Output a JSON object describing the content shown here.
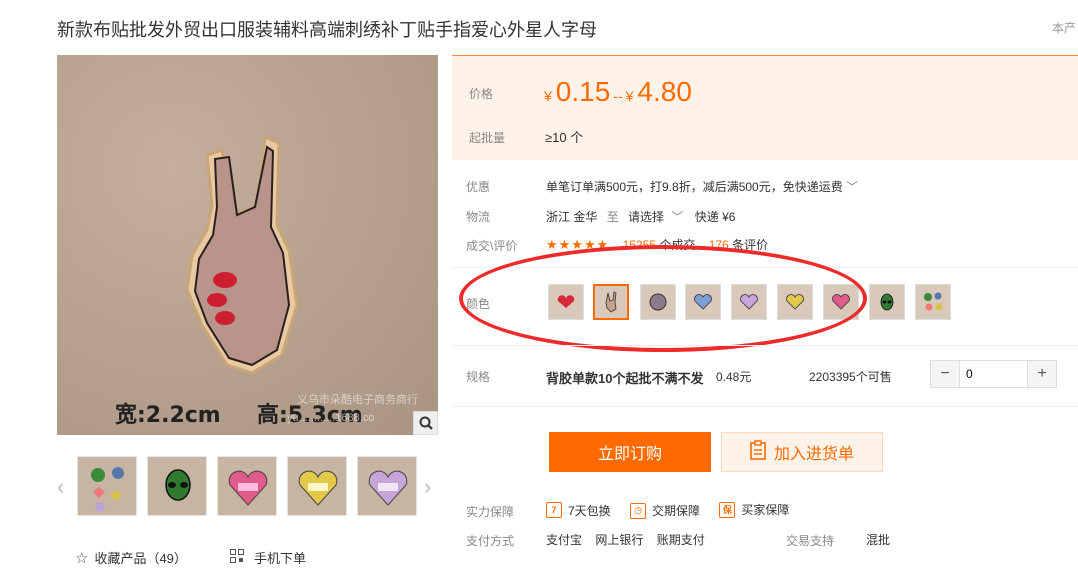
{
  "product": {
    "title": "新款布贴批发外贸出口服装辅料高端刺绣补丁贴手指爱心外星人字母",
    "title_right": "本产",
    "image_dim_w": "宽:2.2cm",
    "image_dim_h": "高:5.3cm",
    "watermark": "义乌市朵酷电子商务商行",
    "watermark2": "yu............1688.co"
  },
  "price": {
    "label": "价格",
    "currency": "¥",
    "low": "0.15",
    "sep": "--",
    "high": "4.80",
    "moq_label": "起批量",
    "moq_value": "≥10 个"
  },
  "promo": {
    "label": "优惠",
    "text": "单笔订单满500元，打9.8折，减后满500元，免快递运费"
  },
  "logistics": {
    "label": "物流",
    "origin": "浙江 金华",
    "to": "至",
    "select": "请选择",
    "express": "快递 ¥6"
  },
  "reviews": {
    "label": "成交\\评价",
    "stars": "★★★★★",
    "deals": "15255",
    "deals_suffix": "个成交",
    "count": "176",
    "count_suffix": "条评价"
  },
  "color": {
    "label": "颜色",
    "swatches": [
      "heart-red",
      "peace-hand",
      "grey-patch",
      "blue-heart",
      "purple-heart",
      "yellow-heart",
      "pink-heart",
      "alien",
      "mixed"
    ]
  },
  "spec": {
    "label": "规格",
    "name": "背胶单款10个起批不满不发",
    "price": "0.48元",
    "stock": "2203395个可售",
    "qty": "0",
    "minus": "−",
    "plus": "+"
  },
  "actions": {
    "buy": "立即订购",
    "cart": "加入进货单"
  },
  "guarantee": {
    "label": "实力保障",
    "items": [
      "7天包换",
      "交期保障",
      "买家保障"
    ]
  },
  "payment": {
    "label": "支付方式",
    "items": [
      "支付宝",
      "网上银行",
      "账期支付"
    ],
    "trade_label": "交易支持",
    "trade_value": "混批"
  },
  "footer": {
    "fav": "收藏产品（49）",
    "mobile": "手机下单"
  },
  "colors": {
    "accent": "#ff6a00",
    "panel": "#fff2e8",
    "annotation": "#ee2b2b"
  }
}
